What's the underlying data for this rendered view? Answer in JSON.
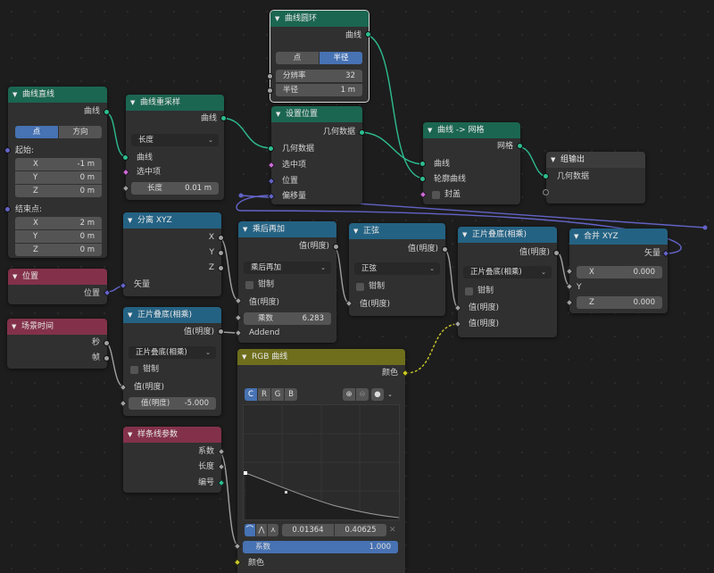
{
  "nodes": {
    "curve_circle": {
      "title": "曲线圆环",
      "out_curve": "曲线",
      "mode_points": "点",
      "mode_radius": "半径",
      "resolution_label": "分辨率",
      "resolution_value": "32",
      "radius_label": "半径",
      "radius_value": "1 m"
    },
    "curve_line": {
      "title": "曲线直线",
      "out_curve": "曲线",
      "mode_points": "点",
      "mode_direction": "方向",
      "start_label": "起始:",
      "start": [
        {
          "axis": "X",
          "value": "-1 m"
        },
        {
          "axis": "Y",
          "value": "0 m"
        },
        {
          "axis": "Z",
          "value": "0 m"
        }
      ],
      "end_label": "结束点:",
      "end": [
        {
          "axis": "X",
          "value": "2 m"
        },
        {
          "axis": "Y",
          "value": "0 m"
        },
        {
          "axis": "Z",
          "value": "0 m"
        }
      ]
    },
    "resample": {
      "title": "曲线重采样",
      "out_curve": "曲线",
      "mode": "长度",
      "in_curve": "曲线",
      "in_selection": "选中项",
      "length_label": "长度",
      "length_value": "0.01 m"
    },
    "set_position": {
      "title": "设置位置",
      "out_geometry": "几何数据",
      "in_geometry": "几何数据",
      "in_selection": "选中项",
      "in_position": "位置",
      "in_offset": "偏移量"
    },
    "curve_to_mesh": {
      "title": "曲线 -> 网格",
      "out_mesh": "网格",
      "in_curve": "曲线",
      "in_profile": "轮廓曲线",
      "fill_caps": "封盖"
    },
    "group_output": {
      "title": "组输出",
      "in_geometry": "几何数据"
    },
    "position": {
      "title": "位置",
      "out_position": "位置"
    },
    "separate_xyz": {
      "title": "分离 XYZ",
      "out_x": "X",
      "out_y": "Y",
      "out_z": "Z",
      "in_vector": "矢量"
    },
    "multiply_add": {
      "title": "乘后再加",
      "out_value": "值(明度)",
      "mode": "乘后再加",
      "clamp": "钳制",
      "in_value": "值(明度)",
      "multiplier_label": "乘数",
      "multiplier_value": "6.283",
      "addend": "Addend"
    },
    "sine": {
      "title": "正弦",
      "out_value": "值(明度)",
      "mode": "正弦",
      "clamp": "钳制",
      "in_value": "值(明度)"
    },
    "multiply_right": {
      "title": "正片叠底(相乘)",
      "out_value": "值(明度)",
      "mode": "正片叠底(相乘)",
      "clamp": "钳制",
      "in_value1": "值(明度)",
      "in_value2": "值(明度)"
    },
    "combine_xyz": {
      "title": "合并 XYZ",
      "out_vector": "矢量",
      "x_label": "X",
      "x_value": "0.000",
      "y_label": "Y",
      "z_label": "Z",
      "z_value": "0.000"
    },
    "scene_time": {
      "title": "场景时间",
      "out_seconds": "秒",
      "out_frame": "帧"
    },
    "multiply_left": {
      "title": "正片叠底(相乘)",
      "out_value": "值(明度)",
      "mode": "正片叠底(相乘)",
      "clamp": "钳制",
      "in_value": "值(明度)",
      "value2_label": "值(明度)",
      "value2_value": "-5.000"
    },
    "rgb_curves": {
      "title": "RGB 曲线",
      "out_color": "颜色",
      "channels": [
        "C",
        "R",
        "G",
        "B"
      ],
      "point_x": "0.01364",
      "point_y": "0.40625",
      "factor_label": "系数",
      "factor_value": "1.000",
      "in_color": "颜色"
    },
    "spline_param": {
      "title": "样条线参数",
      "out_factor": "系数",
      "out_length": "长度",
      "out_index": "编号"
    }
  },
  "colors": {
    "geometry_header": "#1b6651",
    "converter_header": "#246283",
    "input_header": "#83314a",
    "color_header": "#6e6e1d",
    "accent": "#4772b3",
    "geometry_socket": "#2dbd90",
    "float_socket": "#a1a1a1",
    "vector_socket": "#6363c7",
    "color_socket": "#c7c729"
  }
}
